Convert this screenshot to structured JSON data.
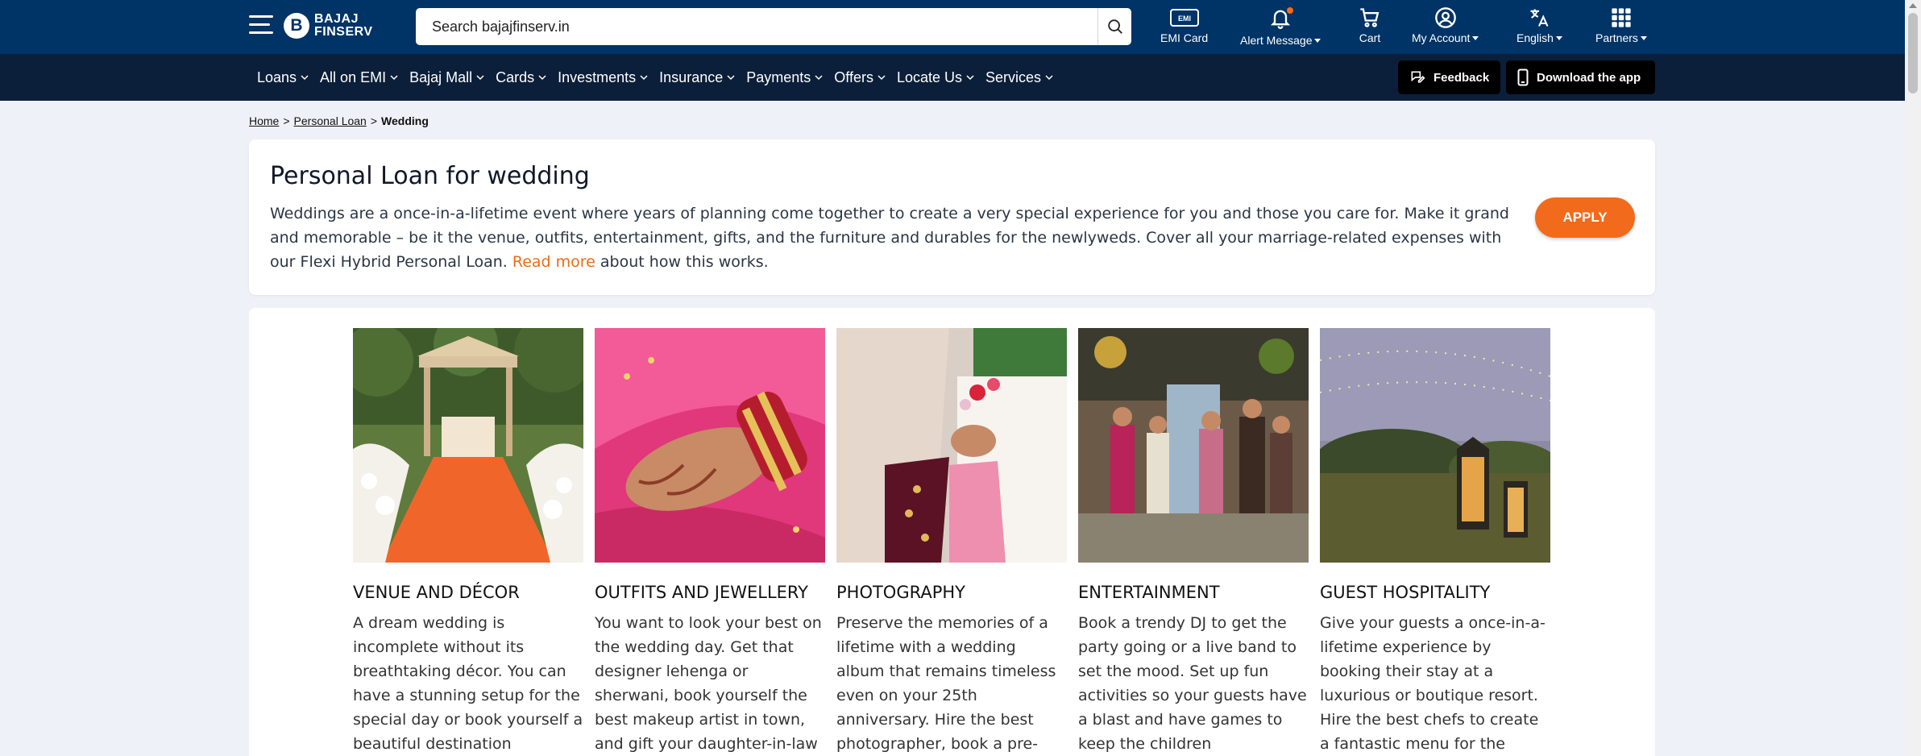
{
  "header": {
    "logo": {
      "mark": "B",
      "line1": "BAJAJ",
      "line2": "FINSERV"
    },
    "search": {
      "placeholder": "Search bajajfinserv.in"
    },
    "tools": [
      {
        "label": "EMI Card",
        "icon": "emi-card-icon"
      },
      {
        "label": "Alert Message",
        "icon": "bell-icon"
      },
      {
        "label": "Cart",
        "icon": "cart-icon"
      },
      {
        "label": "My Account",
        "icon": "user-icon"
      },
      {
        "label": "English",
        "icon": "language-icon"
      },
      {
        "label": "Partners",
        "icon": "grid-icon"
      }
    ],
    "emi_badge": "EMI"
  },
  "nav": {
    "items": [
      "Loans",
      "All on EMI",
      "Bajaj Mall",
      "Cards",
      "Investments",
      "Insurance",
      "Payments",
      "Offers",
      "Locate Us",
      "Services"
    ],
    "feedback": "Feedback",
    "download": "Download the app"
  },
  "breadcrumb": {
    "home": "Home",
    "personal_loan": "Personal Loan",
    "current": "Wedding",
    "separator": ">"
  },
  "intro": {
    "title": "Personal Loan for wedding",
    "text": "Weddings are a once-in-a-lifetime event where years of planning come together to create a very special experience for you and those you care for. Make it grand and memorable – be it the venue, outfits, entertainment, gifts, and the furniture and durables for the newlyweds. Cover all your marriage-related expenses with our Flexi Hybrid Personal Loan. ",
    "read_more": "Read more",
    "text_after": " about how this works.",
    "apply": "APPLY"
  },
  "cards": [
    {
      "title": "VENUE AND DÉCOR",
      "text": "A dream wedding is incomplete without its breathtaking décor. You can have a stunning setup for the special day or book yourself a beautiful destination wedding."
    },
    {
      "title": "OUTFITS AND JEWELLERY",
      "text": "You want to look your best on the wedding day. Get that designer lehenga or sherwani, book yourself the best makeup artist in town, and gift your daughter-in-law some gold"
    },
    {
      "title": "PHOTOGRAPHY",
      "text": "Preserve the memories of a lifetime with a wedding album that remains timeless even on your 25th anniversary. Hire the best photographer, book a pre-wedding shoot, and set up"
    },
    {
      "title": "ENTERTAINMENT",
      "text": "Book a trendy DJ to get the party going or a live band to set the mood. Set up fun activities so your guests have a blast and have games to keep the children entertained."
    },
    {
      "title": "GUEST HOSPITALITY",
      "text": "Give your guests a once-in-a-lifetime experience by booking their stay at a luxurious or boutique resort. Hire the best chefs to create a fantastic menu for the celebrations."
    }
  ],
  "colors": {
    "header": "#003366",
    "nav": "#0b1f3a",
    "accent": "#f26a1b",
    "page_bg": "#eef1f7"
  }
}
